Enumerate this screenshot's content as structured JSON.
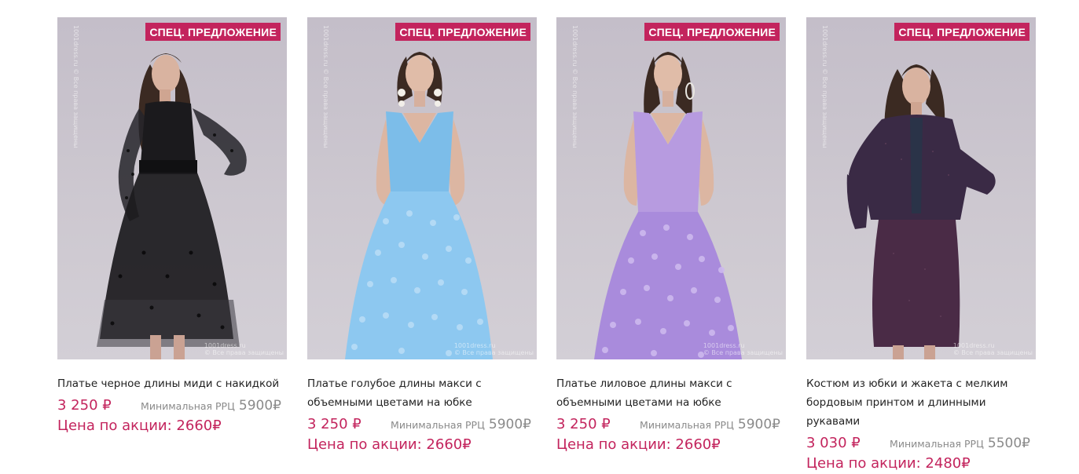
{
  "products": [
    {
      "badge": "СПЕЦ. ПРЕДЛОЖЕНИЕ",
      "watermark_top": "1001dress.ru © Все права защищены",
      "watermark_bottom": "1001dress.ru\n© Все права защищены",
      "title": "Платье черное длины миди с накидкой",
      "price": "3 250",
      "rrp_label": "Минимальная РРЦ",
      "rrp_value": "5900",
      "promo_label": "Цена по акции:",
      "promo_value": "2660",
      "currency": "₽",
      "dress_color": "#1b1a1d",
      "image": "photo-black-polka-dot-midi-dress"
    },
    {
      "badge": "СПЕЦ. ПРЕДЛОЖЕНИЕ",
      "watermark_top": "1001dress.ru © Все права защищены",
      "watermark_bottom": "1001dress.ru\n© Все права защищены",
      "title": "Платье голубое длины макси с объемными цветами на юбке",
      "price": "3 250",
      "rrp_label": "Минимальная РРЦ",
      "rrp_value": "5900",
      "promo_label": "Цена по акции:",
      "promo_value": "2660",
      "currency": "₽",
      "dress_color": "#7cbde9",
      "image": "photo-blue-floral-maxi-dress"
    },
    {
      "badge": "СПЕЦ. ПРЕДЛОЖЕНИЕ",
      "watermark_top": "1001dress.ru © Все права защищены",
      "watermark_bottom": "1001dress.ru\n© Все права защищены",
      "title": "Платье лиловое длины макси с объемными цветами на юбке",
      "price": "3 250",
      "rrp_label": "Минимальная РРЦ",
      "rrp_value": "5900",
      "promo_label": "Цена по акции:",
      "promo_value": "2660",
      "currency": "₽",
      "dress_color": "#b79be0",
      "image": "photo-lilac-floral-maxi-dress"
    },
    {
      "badge": "СПЕЦ. ПРЕДЛОЖЕНИЕ",
      "watermark_top": "1001dress.ru © Все права защищены",
      "watermark_bottom": "1001dress.ru\n© Все права защищены",
      "title": "Костюм из юбки и жакета с мелким бордовым принтом и длинными рукавами",
      "price": "3 030",
      "rrp_label": "Минимальная РРЦ",
      "rrp_value": "5500",
      "promo_label": "Цена по акции:",
      "promo_value": "2480",
      "currency": "₽",
      "dress_color": "#3a2a45",
      "image": "photo-burgundy-print-skirt-jacket-suit"
    }
  ],
  "colors": {
    "accent": "#c3245d",
    "muted": "#8a8a8a",
    "text": "#222222"
  }
}
